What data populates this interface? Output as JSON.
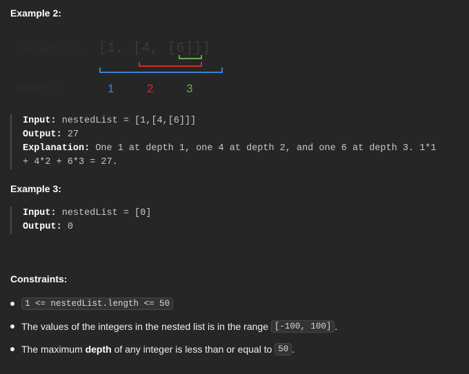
{
  "example2": {
    "heading": "Example 2:",
    "illustration": {
      "list_label": "nestedList =",
      "list_text": "[1, [4, [6]]]",
      "depth_label": "depth =",
      "depths": [
        "1",
        "2",
        "3"
      ],
      "colors": {
        "depth1": "#3b82d6",
        "depth2": "#d42a2a",
        "depth3": "#6aa84f"
      }
    },
    "input_label": "Input:",
    "input_value": "nestedList = [1,[4,[6]]]",
    "output_label": "Output:",
    "output_value": "27",
    "explanation_label": "Explanation:",
    "explanation_line1": "One 1 at depth 1, one 4 at depth 2, and one 6 at depth 3. 1*1",
    "explanation_line2": "+ 4*2 + 6*3 = 27."
  },
  "example3": {
    "heading": "Example 3:",
    "input_label": "Input:",
    "input_value": "nestedList = [0]",
    "output_label": "Output:",
    "output_value": "0"
  },
  "constraints": {
    "heading": "Constraints:",
    "item1_code": "1 <= nestedList.length <= 50",
    "item2_text": "The values of the integers in the nested list is in the range ",
    "item2_code": "[-100, 100]",
    "item2_suffix": ".",
    "item3_text_pre": "The maximum ",
    "item3_strong": "depth",
    "item3_text_post": " of any integer is less than or equal to ",
    "item3_code": "50",
    "item3_suffix": "."
  }
}
